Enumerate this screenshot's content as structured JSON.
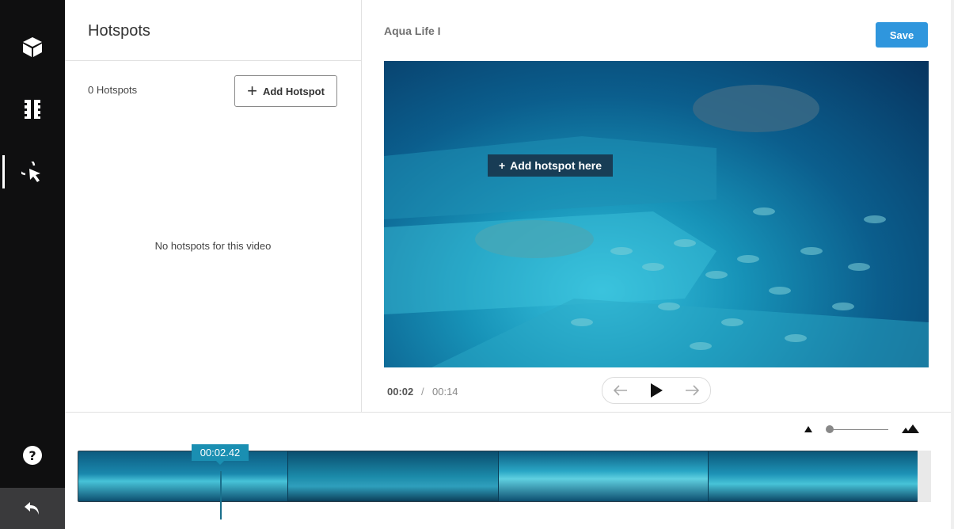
{
  "rail": {
    "items": [
      {
        "icon": "cube-icon"
      },
      {
        "icon": "film-icon"
      },
      {
        "icon": "cursor-click-icon"
      }
    ],
    "help_icon": "question-icon",
    "back_icon": "undo-arrow-icon"
  },
  "hotspots_panel": {
    "title": "Hotspots",
    "count_label": "0 Hotspots",
    "add_button_label": "Add Hotspot",
    "empty_message": "No hotspots for this video"
  },
  "video": {
    "title": "Aqua Life I",
    "save_label": "Save",
    "add_here_label": "Add hotspot here",
    "time_current": "00:02",
    "time_separator": "/",
    "time_total": "00:14"
  },
  "timeline": {
    "playhead_time": "00:02.42",
    "frame_count": 4,
    "zoom_level": 0.05
  },
  "colors": {
    "rail_bg": "#0f0f10",
    "accent": "#2f96dd",
    "playhead": "#1a8fb2"
  }
}
